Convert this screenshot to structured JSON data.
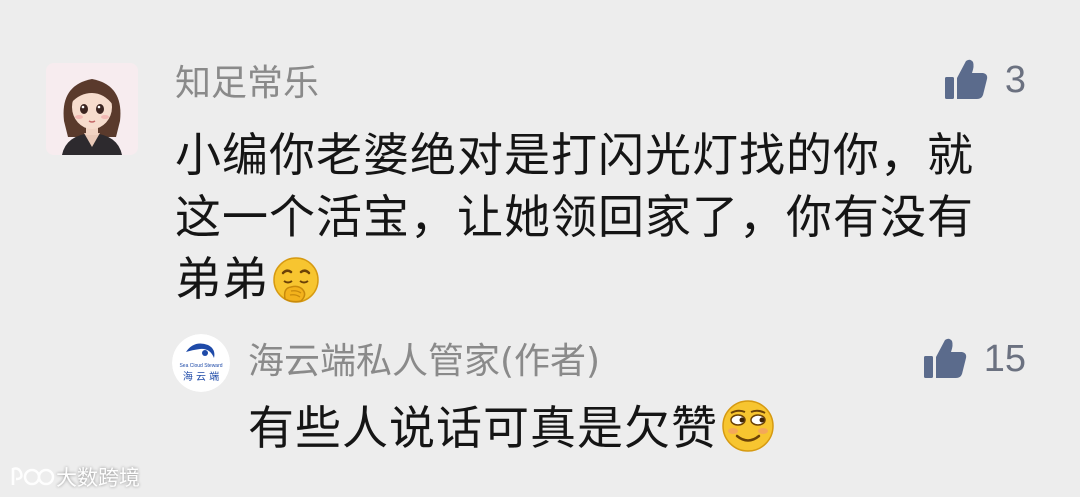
{
  "comments": [
    {
      "username": "知足常乐",
      "text": "小编你老婆绝对是打闪光灯找的你，就这一个活宝，让她领回家了，你有没有弟弟",
      "emoji": "hand-over-mouth-emoji",
      "likes": "3"
    }
  ],
  "reply": {
    "username": "海云端私人管家(作者)",
    "text": "有些人说话可真是欠赞",
    "emoji": "smirk-emoji",
    "likes": "15",
    "avatar_lines": [
      "Sea Cloud Steward",
      "海 云 端"
    ]
  },
  "watermark": {
    "text": "大数跨境"
  },
  "colors": {
    "background": "#ededed",
    "username": "#8a8a8a",
    "comment_text": "#151515",
    "like_icon": "#5b6b8c"
  }
}
